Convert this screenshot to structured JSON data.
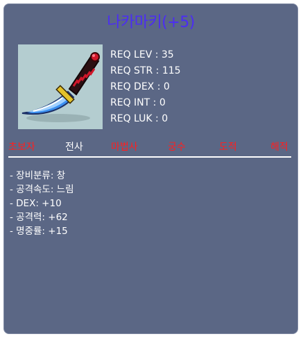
{
  "item": {
    "title": "나카마키(+5)",
    "image_icon": "knife-icon"
  },
  "requirements": [
    "REQ LEV : 35",
    "REQ STR : 115",
    "REQ DEX : 0",
    "REQ INT : 0",
    "REQ LUK : 0"
  ],
  "jobs": [
    {
      "label": "초보자",
      "allowed": false
    },
    {
      "label": "전사",
      "allowed": true
    },
    {
      "label": "마법사",
      "allowed": false
    },
    {
      "label": "궁수",
      "allowed": false
    },
    {
      "label": "도적",
      "allowed": false
    },
    {
      "label": "해적",
      "allowed": false
    }
  ],
  "stats": [
    "- 장비분류: 창",
    "- 공격속도: 느림",
    "- DEX: +10",
    "- 공격력: +62",
    "- 명중률: +15"
  ],
  "colors": {
    "background": "#5b6785",
    "title": "#4b2cf5",
    "job_disallowed": "#ff1f1f",
    "job_allowed": "#ffffff",
    "image_bg": "#b4cdd0"
  }
}
